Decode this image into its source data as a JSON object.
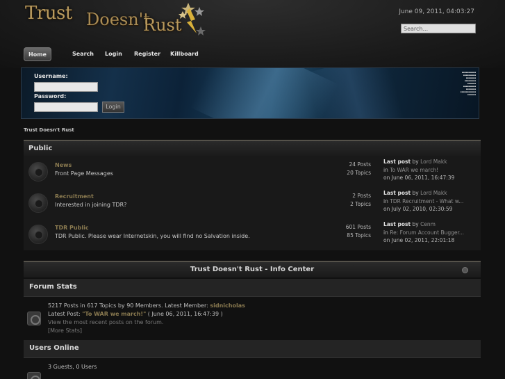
{
  "header": {
    "logo": {
      "word1": "Trust",
      "word2": "Doesn't",
      "word3": "Rust"
    },
    "datetime": "June 09, 2011, 04:03:27",
    "search_placeholder": "Search..."
  },
  "nav": {
    "home": "Home",
    "search": "Search",
    "login": "Login",
    "register": "Register",
    "killboard": "Killboard"
  },
  "login": {
    "username_label": "Username:",
    "password_label": "Password:",
    "button": "Login"
  },
  "breadcrumb": "Trust Doesn't Rust",
  "public": {
    "title": "Public",
    "boards": [
      {
        "name": "News",
        "desc": "Front Page Messages",
        "posts": "24 Posts",
        "topics": "20 Topics",
        "last_label": "Last post",
        "by": "by",
        "user": "Lord Makk",
        "in": "in",
        "topic": "To WAR we march!",
        "on": "on June 06, 2011, 16:47:39"
      },
      {
        "name": "Recruitment",
        "desc": "Interested in joining TDR?",
        "posts": "2 Posts",
        "topics": "2 Topics",
        "last_label": "Last post",
        "by": "by",
        "user": "Lord Makk",
        "in": "in",
        "topic": "TDR Recruitment - What w...",
        "on": "on July 02, 2010, 02:30:59"
      },
      {
        "name": "TDR Public",
        "desc": "TDR Public. Please wear Internetskin, you will find no Salvation inside.",
        "posts": "601 Posts",
        "topics": "85 Topics",
        "last_label": "Last post",
        "by": "by",
        "user": "Cenm",
        "in": "in",
        "topic": "Re: Forum Account Bugger...",
        "on": "on June 02, 2011, 22:01:18"
      }
    ]
  },
  "info": {
    "title": "Trust Doesn't Rust - Info Center",
    "stats_title": "Forum Stats",
    "stats_line1": "5217 Posts in 617 Topics by 90 Members. Latest Member:",
    "latest_member": "sidnicholas",
    "latest_post_prefix": "Latest Post:",
    "latest_post_title": "\"To WAR we march!\"",
    "latest_post_date": "( June 06, 2011, 16:47:39 )",
    "recent_link": "View the most recent posts on the forum.",
    "more_stats": "[More Stats]",
    "users_title": "Users Online",
    "users_line": "3 Guests, 0 Users"
  }
}
